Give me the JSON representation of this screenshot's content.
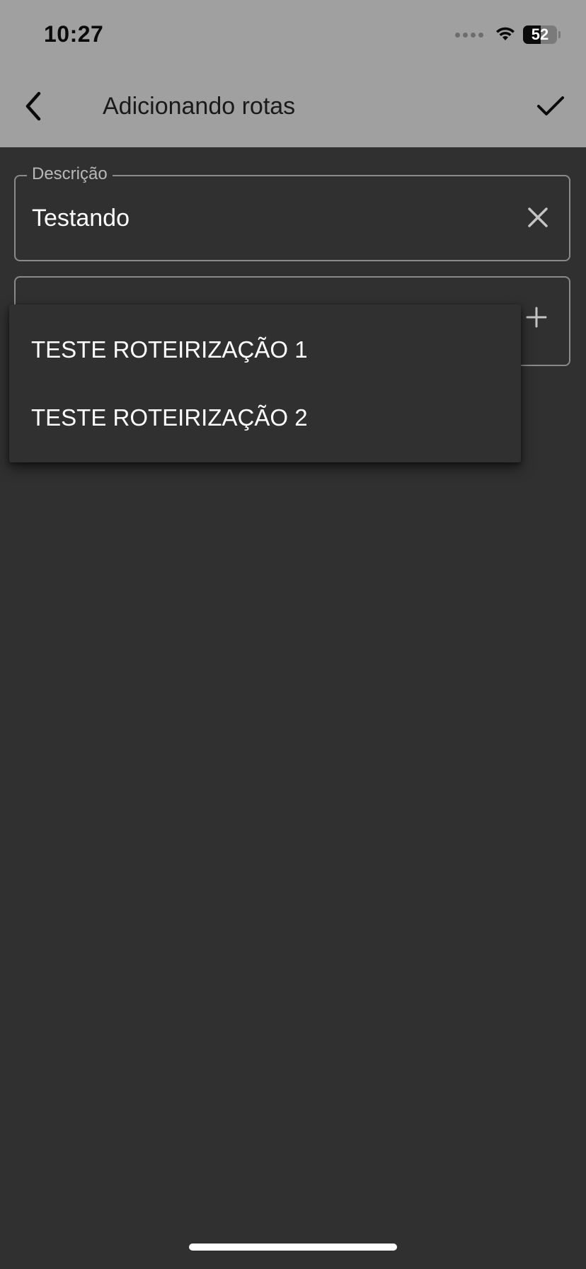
{
  "status_bar": {
    "time": "10:27",
    "battery_level": "52",
    "battery_fraction": 0.52
  },
  "app_bar": {
    "title": "Adicionando rotas",
    "back_icon": "chevron-left-icon",
    "confirm_icon": "check-icon"
  },
  "form": {
    "description": {
      "label": "Descrição",
      "value": "Testando",
      "clear_icon": "close-icon"
    },
    "route": {
      "value": "",
      "add_icon": "plus-icon"
    }
  },
  "dropdown": {
    "options": [
      {
        "label": "TESTE ROTEIRIZAÇÃO 1"
      },
      {
        "label": "TESTE ROTEIRIZAÇÃO 2"
      }
    ]
  },
  "colors": {
    "header_bg": "#a0a0a0",
    "screen_bg": "#303030",
    "field_border": "#8a8a8a",
    "text_primary": "#ffffff"
  }
}
